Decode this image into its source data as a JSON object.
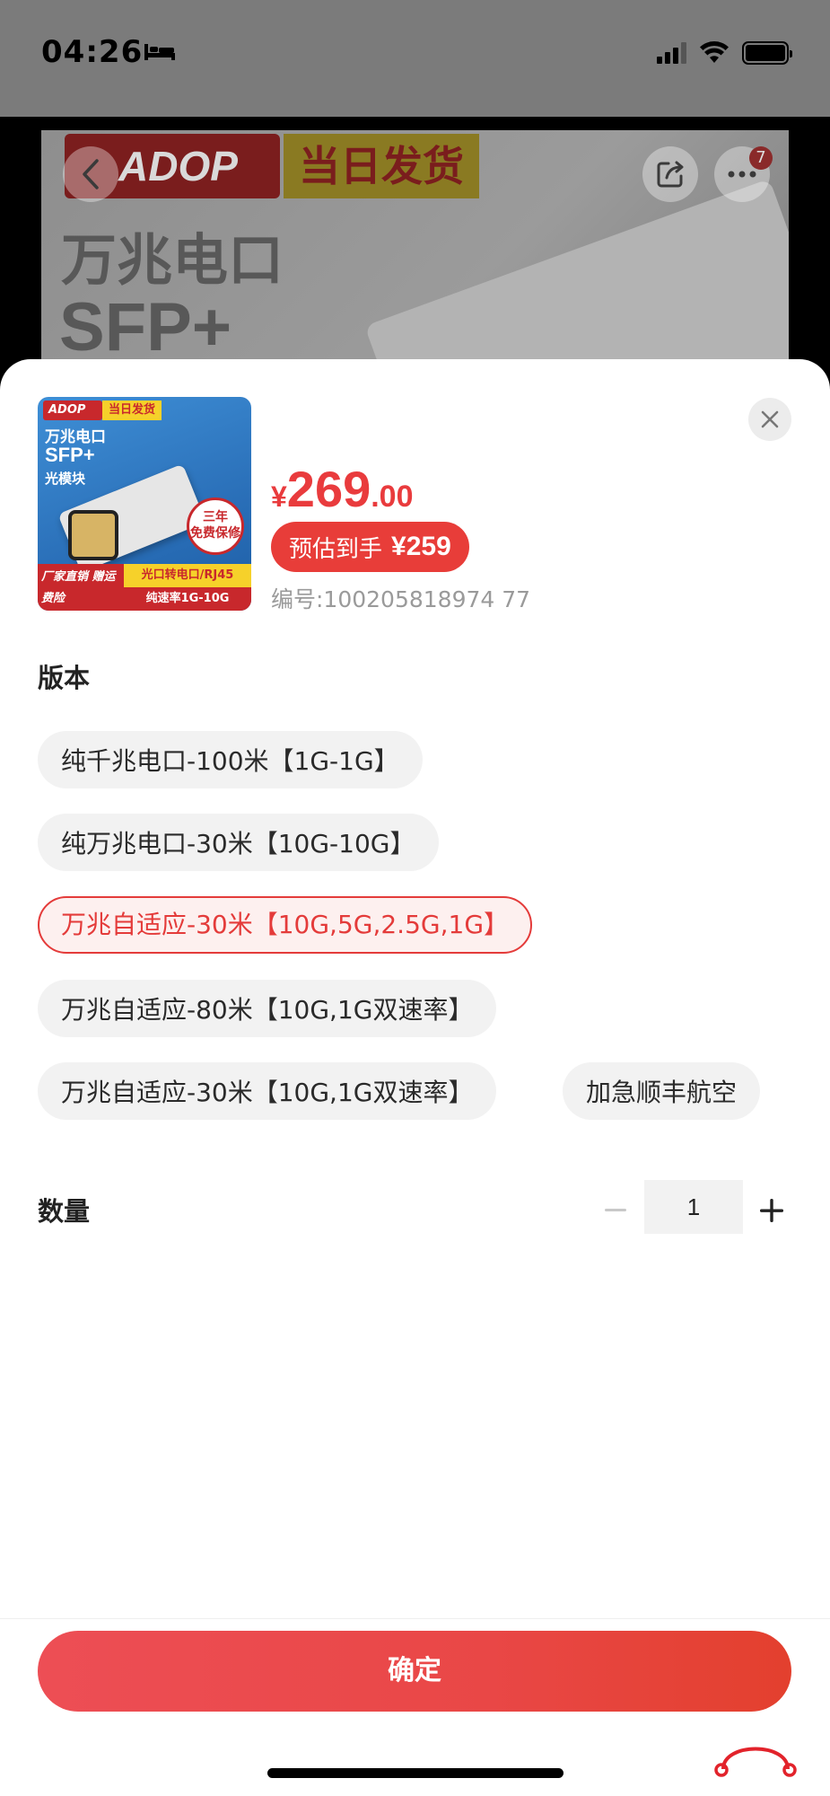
{
  "status_bar": {
    "time": "04:26"
  },
  "banner": {
    "logo_text": "ADOP",
    "tag_text": "当日发货",
    "title_line1": "万兆电口",
    "title_line2": "SFP+",
    "more_badge": "7"
  },
  "product": {
    "thumb": {
      "logo": "ADOP",
      "tag": "当日发货",
      "line1": "万兆电口",
      "line2": "SFP+",
      "line3": "光模块",
      "seal": "三年\n免费保修",
      "bottom_left": "厂家直销 赠运费险",
      "bottom_right1": "光口转电口/RJ45",
      "bottom_right2": "纯速率1G-10G"
    },
    "price_symbol": "¥",
    "price_int": "269",
    "price_dec": ".00",
    "estimate_label": "预估到手",
    "estimate_price": "¥259",
    "sku": "编号:100205818974 77"
  },
  "version": {
    "label": "版本",
    "options": [
      "纯千兆电口-100米【1G-1G】",
      "纯万兆电口-30米【10G-10G】",
      "万兆自适应-30米【10G,5G,2.5G,1G】",
      "万兆自适应-80米【10G,1G双速率】",
      "万兆自适应-30米【10G,1G双速率】",
      "加急顺丰航空"
    ],
    "selected_index": 2
  },
  "quantity": {
    "label": "数量",
    "value": "1"
  },
  "confirm_label": "确定",
  "colors": {
    "accent": "#e93b3d",
    "option_bg": "#f2f2f2",
    "selected_bg": "#fdf0ef"
  }
}
